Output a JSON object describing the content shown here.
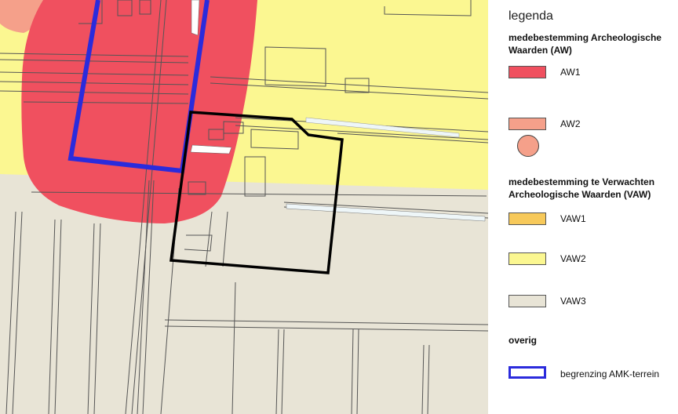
{
  "legend": {
    "title": "legenda",
    "aw_heading": "medebestemming Archeologische Waarden (AW)",
    "vaw_heading": "medebestemming te Verwachten Archeologische Waarden (VAW)",
    "overig_heading": "overig",
    "items": [
      {
        "label": "AW1",
        "color": "#f0505f"
      },
      {
        "label": "AW2",
        "color": "#f5a08a"
      },
      {
        "label": "VAW1",
        "color": "#f7c95a"
      },
      {
        "label": "VAW2",
        "color": "#fbf791"
      },
      {
        "label": "VAW3",
        "color": "#e8e4d6"
      },
      {
        "label": "begrenzing AMK-terrein",
        "color": "#2b2bdc"
      }
    ]
  }
}
